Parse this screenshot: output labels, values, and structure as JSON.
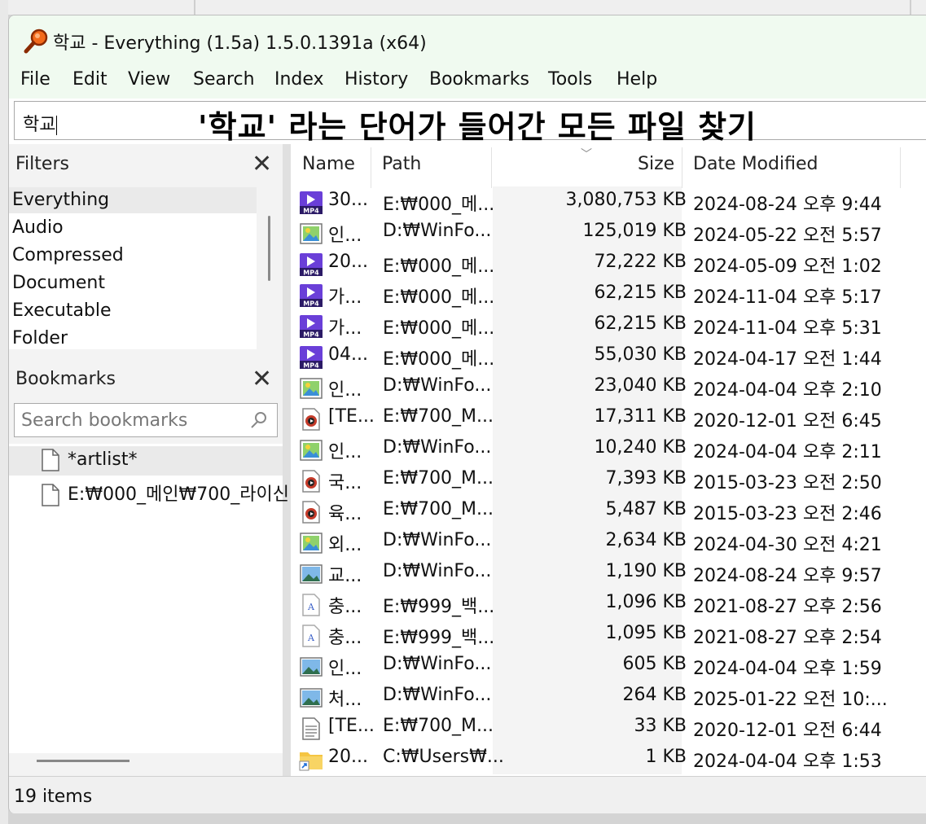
{
  "window": {
    "title": "학교 - Everything (1.5a) 1.5.0.1391a (x64)"
  },
  "menu": [
    "File",
    "Edit",
    "View",
    "Search",
    "Index",
    "History",
    "Bookmarks",
    "Tools",
    "Help"
  ],
  "search": {
    "value": "학교"
  },
  "annotation": "'학교' 라는 단어가 들어간 모든 파일 찾기",
  "filters": {
    "title": "Filters",
    "items": [
      "Everything",
      "Audio",
      "Compressed",
      "Document",
      "Executable",
      "Folder"
    ],
    "selected": "Everything"
  },
  "bookmarks": {
    "title": "Bookmarks",
    "search_placeholder": "Search bookmarks",
    "items": [
      "*artlist*",
      "E:₩000_메인₩700_라이신"
    ]
  },
  "columns": {
    "name": "Name",
    "path": "Path",
    "size": "Size",
    "date": "Date Modified"
  },
  "rows": [
    {
      "icon": "mp4-video-icon",
      "name": "30...",
      "path": "E:₩000_메...",
      "size": "3,080,753 KB",
      "date": "2024-08-24 오후 9:44"
    },
    {
      "icon": "image-icon",
      "name": "인...",
      "path": "D:₩WinFo...",
      "size": "125,019 KB",
      "date": "2024-05-22 오전 5:57"
    },
    {
      "icon": "mp4-video-icon",
      "name": "20...",
      "path": "E:₩000_메...",
      "size": "72,222 KB",
      "date": "2024-05-09 오전 1:02"
    },
    {
      "icon": "mp4-video-icon",
      "name": "가...",
      "path": "E:₩000_메...",
      "size": "62,215 KB",
      "date": "2024-11-04 오후 5:17"
    },
    {
      "icon": "mp4-video-icon",
      "name": "가...",
      "path": "E:₩000_메...",
      "size": "62,215 KB",
      "date": "2024-11-04 오후 5:31"
    },
    {
      "icon": "mp4-video-icon",
      "name": "04...",
      "path": "E:₩000_메...",
      "size": "55,030 KB",
      "date": "2024-04-17 오전 1:44"
    },
    {
      "icon": "image-icon",
      "name": "인...",
      "path": "D:₩WinFo...",
      "size": "23,040 KB",
      "date": "2024-04-04 오후 2:10"
    },
    {
      "icon": "media-icon",
      "name": "[TE...",
      "path": "E:₩700_M...",
      "size": "17,311 KB",
      "date": "2020-12-01 오전 6:45"
    },
    {
      "icon": "image-icon",
      "name": "인...",
      "path": "D:₩WinFo...",
      "size": "10,240 KB",
      "date": "2024-04-04 오후 2:11"
    },
    {
      "icon": "media-icon",
      "name": "국...",
      "path": "E:₩700_M...",
      "size": "7,393 KB",
      "date": "2015-03-23 오전 2:50"
    },
    {
      "icon": "media-icon",
      "name": "육...",
      "path": "E:₩700_M...",
      "size": "5,487 KB",
      "date": "2015-03-23 오전 2:46"
    },
    {
      "icon": "image-icon",
      "name": "외...",
      "path": "D:₩WinFo...",
      "size": "2,634 KB",
      "date": "2024-04-30 오전 4:21"
    },
    {
      "icon": "picture-icon",
      "name": "교...",
      "path": "D:₩WinFo...",
      "size": "1,190 KB",
      "date": "2024-08-24 오후 9:57"
    },
    {
      "icon": "font-icon",
      "name": "충...",
      "path": "E:₩999_백...",
      "size": "1,096 KB",
      "date": "2021-08-27 오후 2:56"
    },
    {
      "icon": "font-icon",
      "name": "충...",
      "path": "E:₩999_백...",
      "size": "1,095 KB",
      "date": "2021-08-27 오후 2:54"
    },
    {
      "icon": "picture-icon",
      "name": "인...",
      "path": "D:₩WinFo...",
      "size": "605 KB",
      "date": "2024-04-04 오후 1:59"
    },
    {
      "icon": "picture-icon",
      "name": "처...",
      "path": "D:₩WinFo...",
      "size": "264 KB",
      "date": "2025-01-22 오전 10:..."
    },
    {
      "icon": "text-file-icon",
      "name": "[TE...",
      "path": "E:₩700_M...",
      "size": "33 KB",
      "date": "2020-12-01 오전 6:44"
    },
    {
      "icon": "folder-shortcut-icon",
      "name": "20...",
      "path": "C:₩Users₩...",
      "size": "1 KB",
      "date": "2024-04-04 오후 1:53"
    }
  ],
  "status": {
    "count": "19 items"
  }
}
